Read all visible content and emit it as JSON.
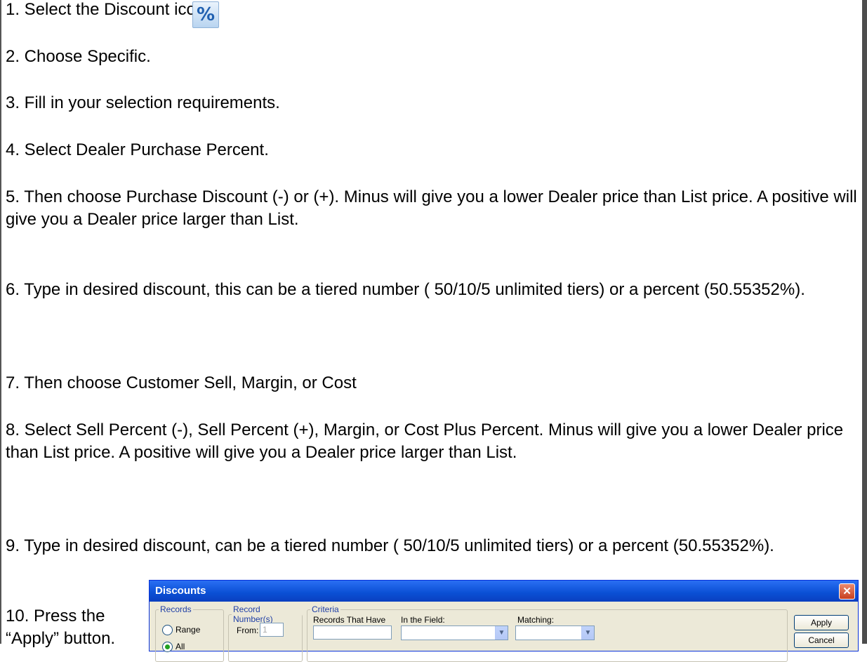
{
  "steps": [
    "1.  Select the Discount icon.",
    "2. Choose Specific.",
    "3. Fill in your selection requirements.",
    "4. Select Dealer Purchase Percent.",
    "5. Then choose Purchase Discount (-) or (+). Minus will give you a lower Dealer price than List price. A positive will give you a Dealer price larger than List.",
    "6. Type in desired discount, this can be a tiered number ( 50/10/5 unlimited tiers) or a percent (50.55352%).",
    "7. Then choose Customer Sell, Margin, or Cost",
    "8. Select Sell Percent (-), Sell Percent (+), Margin, or Cost Plus Percent. Minus will give you a lower Dealer price than List price. A positive will give you a Dealer price larger than List.",
    "9. Type in desired discount, can be a tiered number ( 50/10/5 unlimited tiers) or a percent (50.55352%).",
    "10. Press the “Apply” button."
  ],
  "discount_icon": {
    "glyph": "%",
    "icon": "percent-icon"
  },
  "dialog": {
    "title": "Discounts",
    "close_glyph": "✕",
    "records": {
      "legend": "Records",
      "range_label": "Range",
      "all_label": "All",
      "selected": "All"
    },
    "record_numbers": {
      "legend": "Record Number(s)",
      "from_label": "From:",
      "from_value": "1"
    },
    "criteria": {
      "legend": "Criteria",
      "records_that_have_label": "Records That Have",
      "in_the_field_label": "In the Field:",
      "matching_label": "Matching:",
      "records_that_have_value": "",
      "in_the_field_value": "",
      "matching_value": ""
    },
    "apply_label": "Apply",
    "cancel_label": "Cancel"
  }
}
